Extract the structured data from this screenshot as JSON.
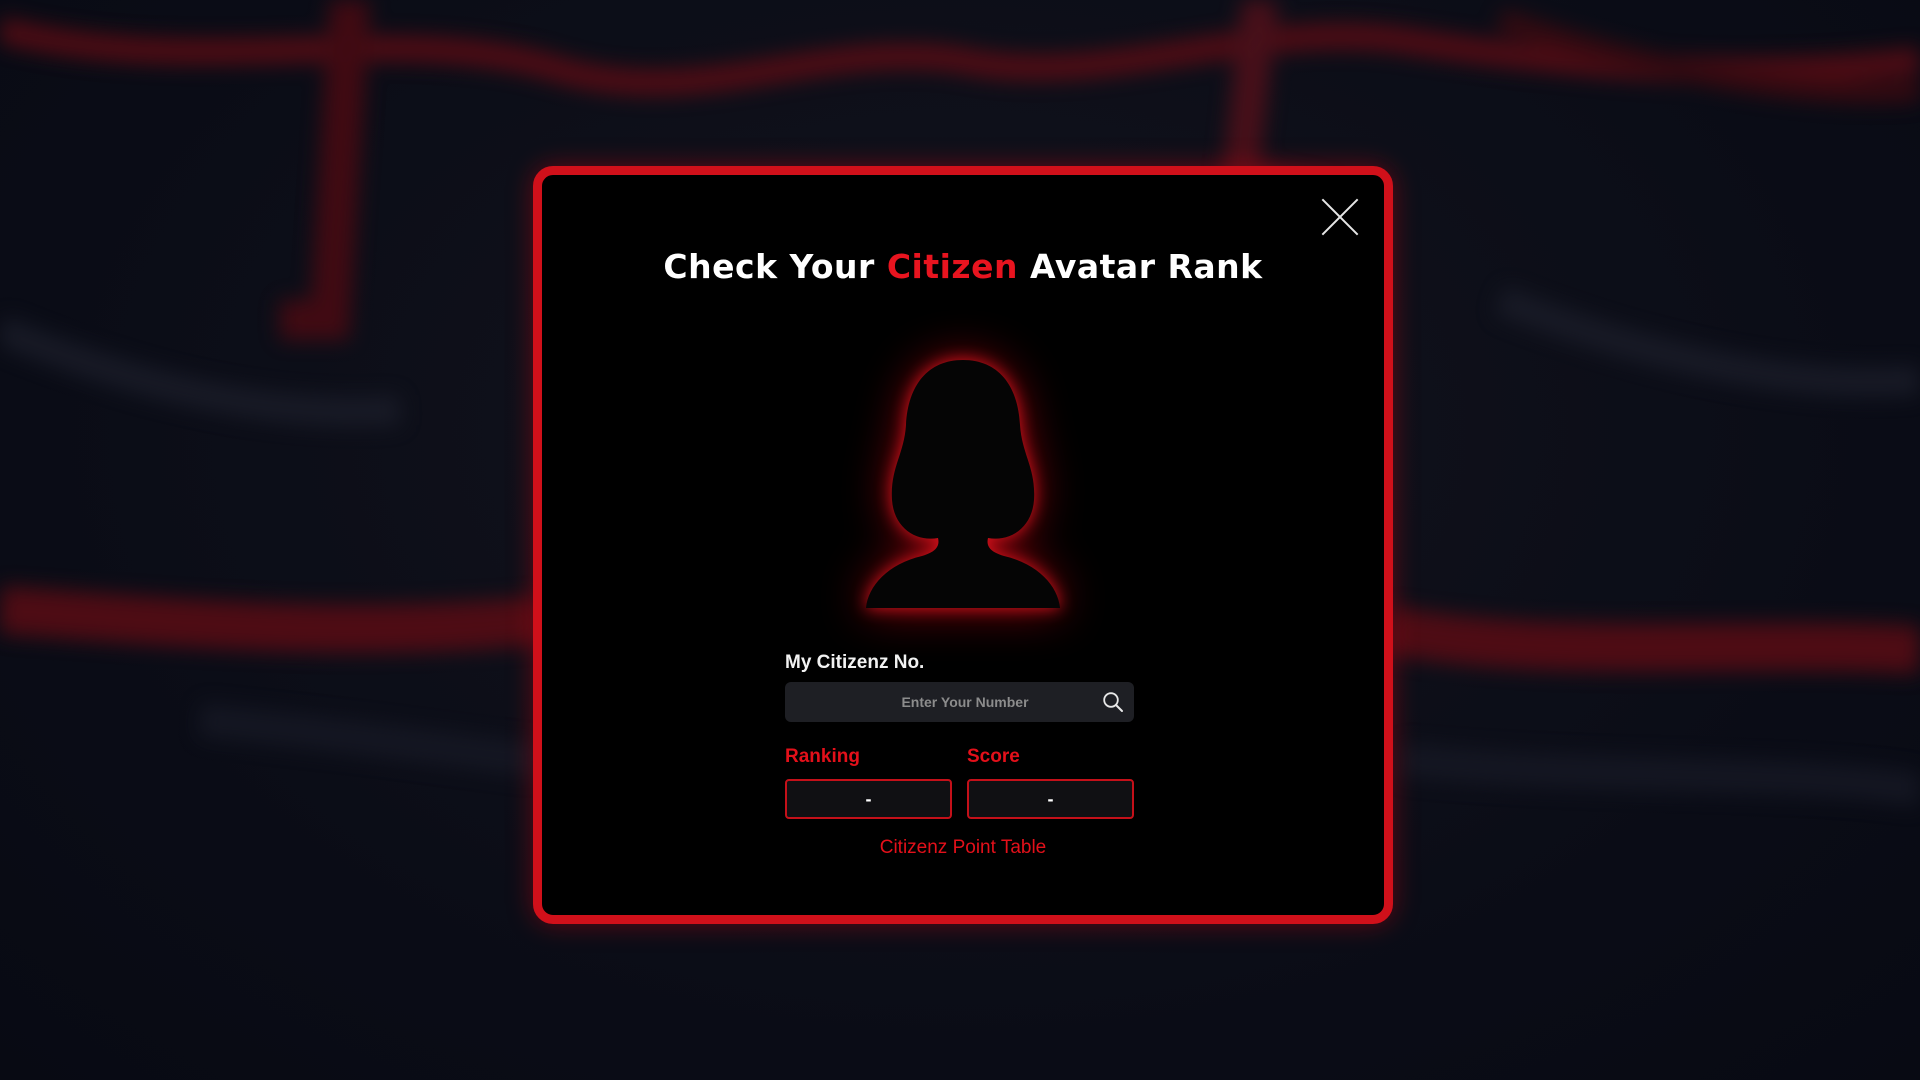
{
  "modal": {
    "title_prefix": "Check Your ",
    "title_accent": "Citizen",
    "title_suffix": " Avatar Rank",
    "close_icon": "close-icon",
    "avatar_icon": "female-silhouette-icon"
  },
  "search": {
    "label": "My Citizenz No.",
    "placeholder": "Enter Your Number",
    "value": "",
    "icon": "search-icon"
  },
  "stats": {
    "ranking_label": "Ranking",
    "ranking_value": "-",
    "score_label": "Score",
    "score_value": "-"
  },
  "footer": {
    "link_label": "Citizenz Point Table"
  },
  "colors": {
    "accent": "#e3101a",
    "border": "#d0101a",
    "modal_bg": "#000000",
    "page_bg": "#0b0d17",
    "input_bg": "#1e1f24"
  }
}
